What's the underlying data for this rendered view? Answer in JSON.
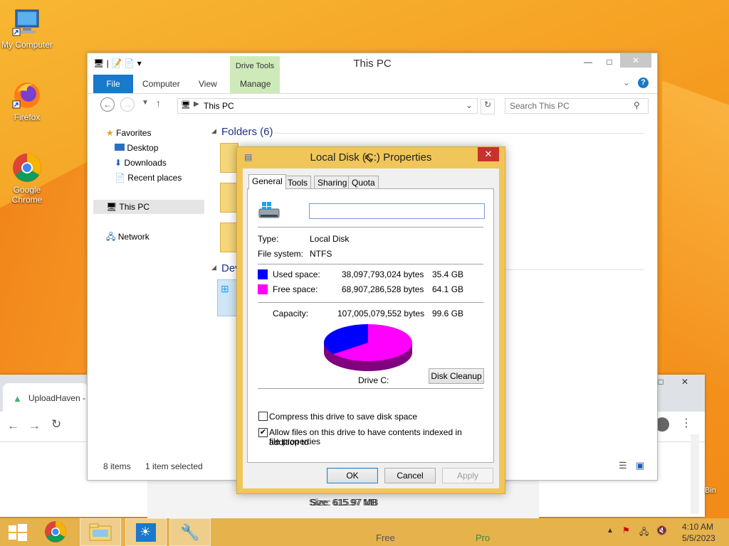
{
  "desktop": {
    "icons": [
      {
        "label": "My Computer"
      },
      {
        "label": "Firefox"
      },
      {
        "label": "Google Chrome"
      }
    ],
    "recycle_partial": "Bin"
  },
  "browser": {
    "tab_title": "UploadHaven -",
    "size_text": "Size: 615.97 MB",
    "free_label": "Free",
    "pro_label": "Pro"
  },
  "explorer": {
    "title": "This PC",
    "ribbon_tabs": {
      "file": "File",
      "computer": "Computer",
      "view": "View",
      "manage": "Manage",
      "drive_tools": "Drive Tools"
    },
    "address": "This PC",
    "search_placeholder": "Search This PC",
    "nav": {
      "favorites": "Favorites",
      "desktop": "Desktop",
      "downloads": "Downloads",
      "recent": "Recent places",
      "this_pc": "This PC",
      "network": "Network"
    },
    "folders_header": "Folders (6)",
    "devices_header_partial": "Dev",
    "status": {
      "items": "8 items",
      "selected": "1 item selected"
    }
  },
  "dialog": {
    "title": "Local Disk (C:) Properties",
    "tabs": [
      "General",
      "Tools",
      "Sharing",
      "Quota"
    ],
    "label_value": "",
    "type_label": "Type:",
    "type_value": "Local Disk",
    "fs_label": "File system:",
    "fs_value": "NTFS",
    "used_label": "Used space:",
    "used_bytes": "38,097,793,024 bytes",
    "used_gb": "35.4 GB",
    "free_label": "Free space:",
    "free_bytes": "68,907,286,528 bytes",
    "free_gb": "64.1 GB",
    "capacity_label": "Capacity:",
    "capacity_bytes": "107,005,079,552 bytes",
    "capacity_gb": "99.6 GB",
    "drive_label": "Drive C:",
    "disk_cleanup": "Disk Cleanup",
    "compress_label": "Compress this drive to save disk space",
    "index_label_1": "Allow files on this drive to have contents indexed in addition to",
    "index_label_2": "file properties",
    "ok": "OK",
    "cancel": "Cancel",
    "apply": "Apply",
    "colors": {
      "used": "#0000ff",
      "free": "#ff00ff"
    },
    "used_fraction": 0.356
  },
  "taskbar": {
    "time": "4:10 AM",
    "date": "5/5/2023"
  }
}
